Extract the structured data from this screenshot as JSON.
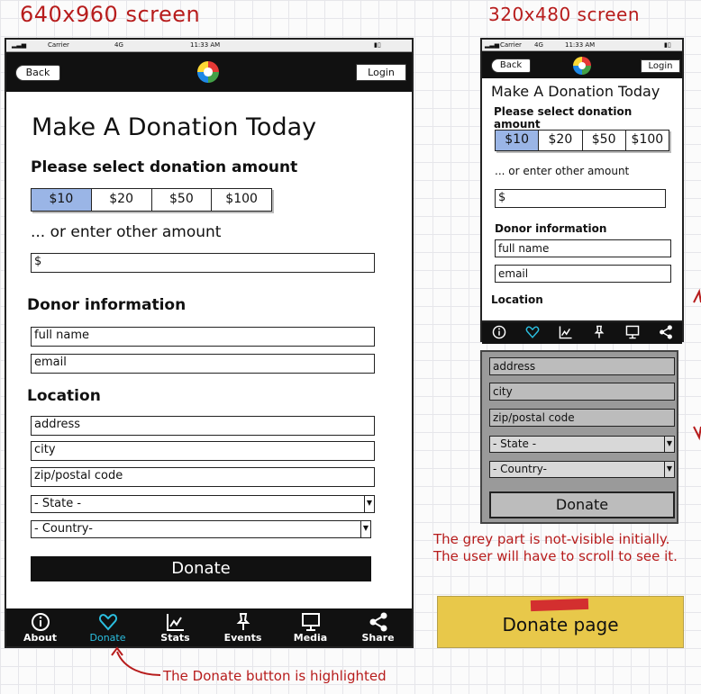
{
  "headings": {
    "large": "640x960 screen",
    "small": "320x480 screen"
  },
  "status_bar": {
    "carrier": "Carrier",
    "network": "4G",
    "time": "11:33 AM"
  },
  "nav": {
    "back_label": "Back",
    "login_label": "Login"
  },
  "form": {
    "title": "Make A Donation Today",
    "select_amount_label": "Please select donation amount",
    "amounts": [
      "$10",
      "$20",
      "$50",
      "$100"
    ],
    "selected_amount": "$10",
    "other_amount_label": "... or enter other amount",
    "amount_placeholder": "$",
    "donor_section": "Donor information",
    "fullname_placeholder": "full name",
    "email_placeholder": "email",
    "location_section": "Location",
    "address_placeholder": "address",
    "city_placeholder": "city",
    "zip_placeholder": "zip/postal code",
    "state_option": "- State -",
    "country_option": "- Country-",
    "donate_label": "Donate"
  },
  "tabs": [
    "About",
    "Donate",
    "Stats",
    "Events",
    "Media",
    "Share"
  ],
  "active_tab": "Donate",
  "notes": {
    "grey_part": "The grey part is not-visible initially.",
    "scroll": "The user will have to scroll to see it.",
    "highlight": "The Donate button is highlighted"
  },
  "sticky_label": "Donate page",
  "colors": {
    "annotation": "#b71c1c",
    "selected": "#9ab5e6",
    "active_tab": "#2bbfe0",
    "sticky": "#e8c84a",
    "tape": "#d32f2f"
  }
}
